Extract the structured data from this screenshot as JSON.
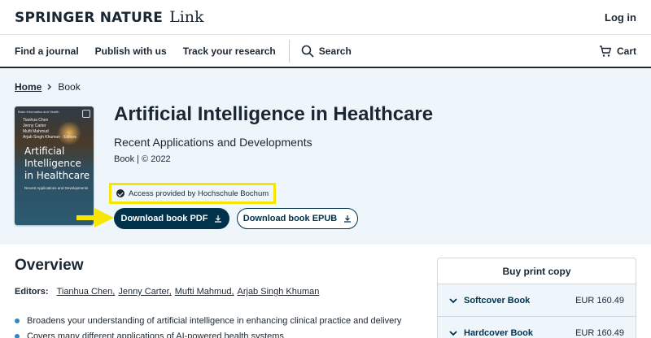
{
  "header": {
    "brand_main": "SPRINGER NATURE",
    "brand_link": "Link",
    "login_label": "Log in"
  },
  "nav": {
    "items": [
      "Find a journal",
      "Publish with us",
      "Track your research"
    ],
    "search_label": "Search",
    "cart_label": "Cart"
  },
  "breadcrumb": {
    "home": "Home",
    "current": "Book"
  },
  "cover": {
    "series": "Brain Informatics and Health",
    "authors": [
      "Tianhua Chen",
      "Jenny Carter",
      "Mufti Mahmud",
      "Arjab Singh Khuman · Editors"
    ],
    "title": "Artificial Intelligence in Healthcare",
    "subtitle": "Recent Applications and Developments"
  },
  "book": {
    "title": "Artificial Intelligence in Healthcare",
    "subtitle": "Recent Applications and Developments",
    "meta": "Book  |  © 2022",
    "access": "Access provided by Hochschule Bochum"
  },
  "buttons": {
    "download_pdf": "Download book PDF",
    "download_epub": "Download book EPUB"
  },
  "overview": {
    "heading": "Overview",
    "editors_label": "Editors:",
    "editors": [
      "Tianhua Chen,",
      "Jenny Carter,",
      "Mufti Mahmud,",
      "Arjab Singh Khuman"
    ],
    "bullets": [
      "Broadens your understanding of artificial intelligence in enhancing clinical practice and delivery",
      "Covers many different applications of AI-powered health systems"
    ]
  },
  "buy": {
    "title": "Buy print copy",
    "options": [
      {
        "format": "Softcover Book",
        "price": "EUR 160.49"
      },
      {
        "format": "Hardcover Book",
        "price": "EUR 160.49"
      }
    ]
  },
  "colors": {
    "primary": "#01324b",
    "hero_bg": "#eef6fc",
    "highlight": "#f7e600",
    "bullet": "#2f86c8"
  }
}
